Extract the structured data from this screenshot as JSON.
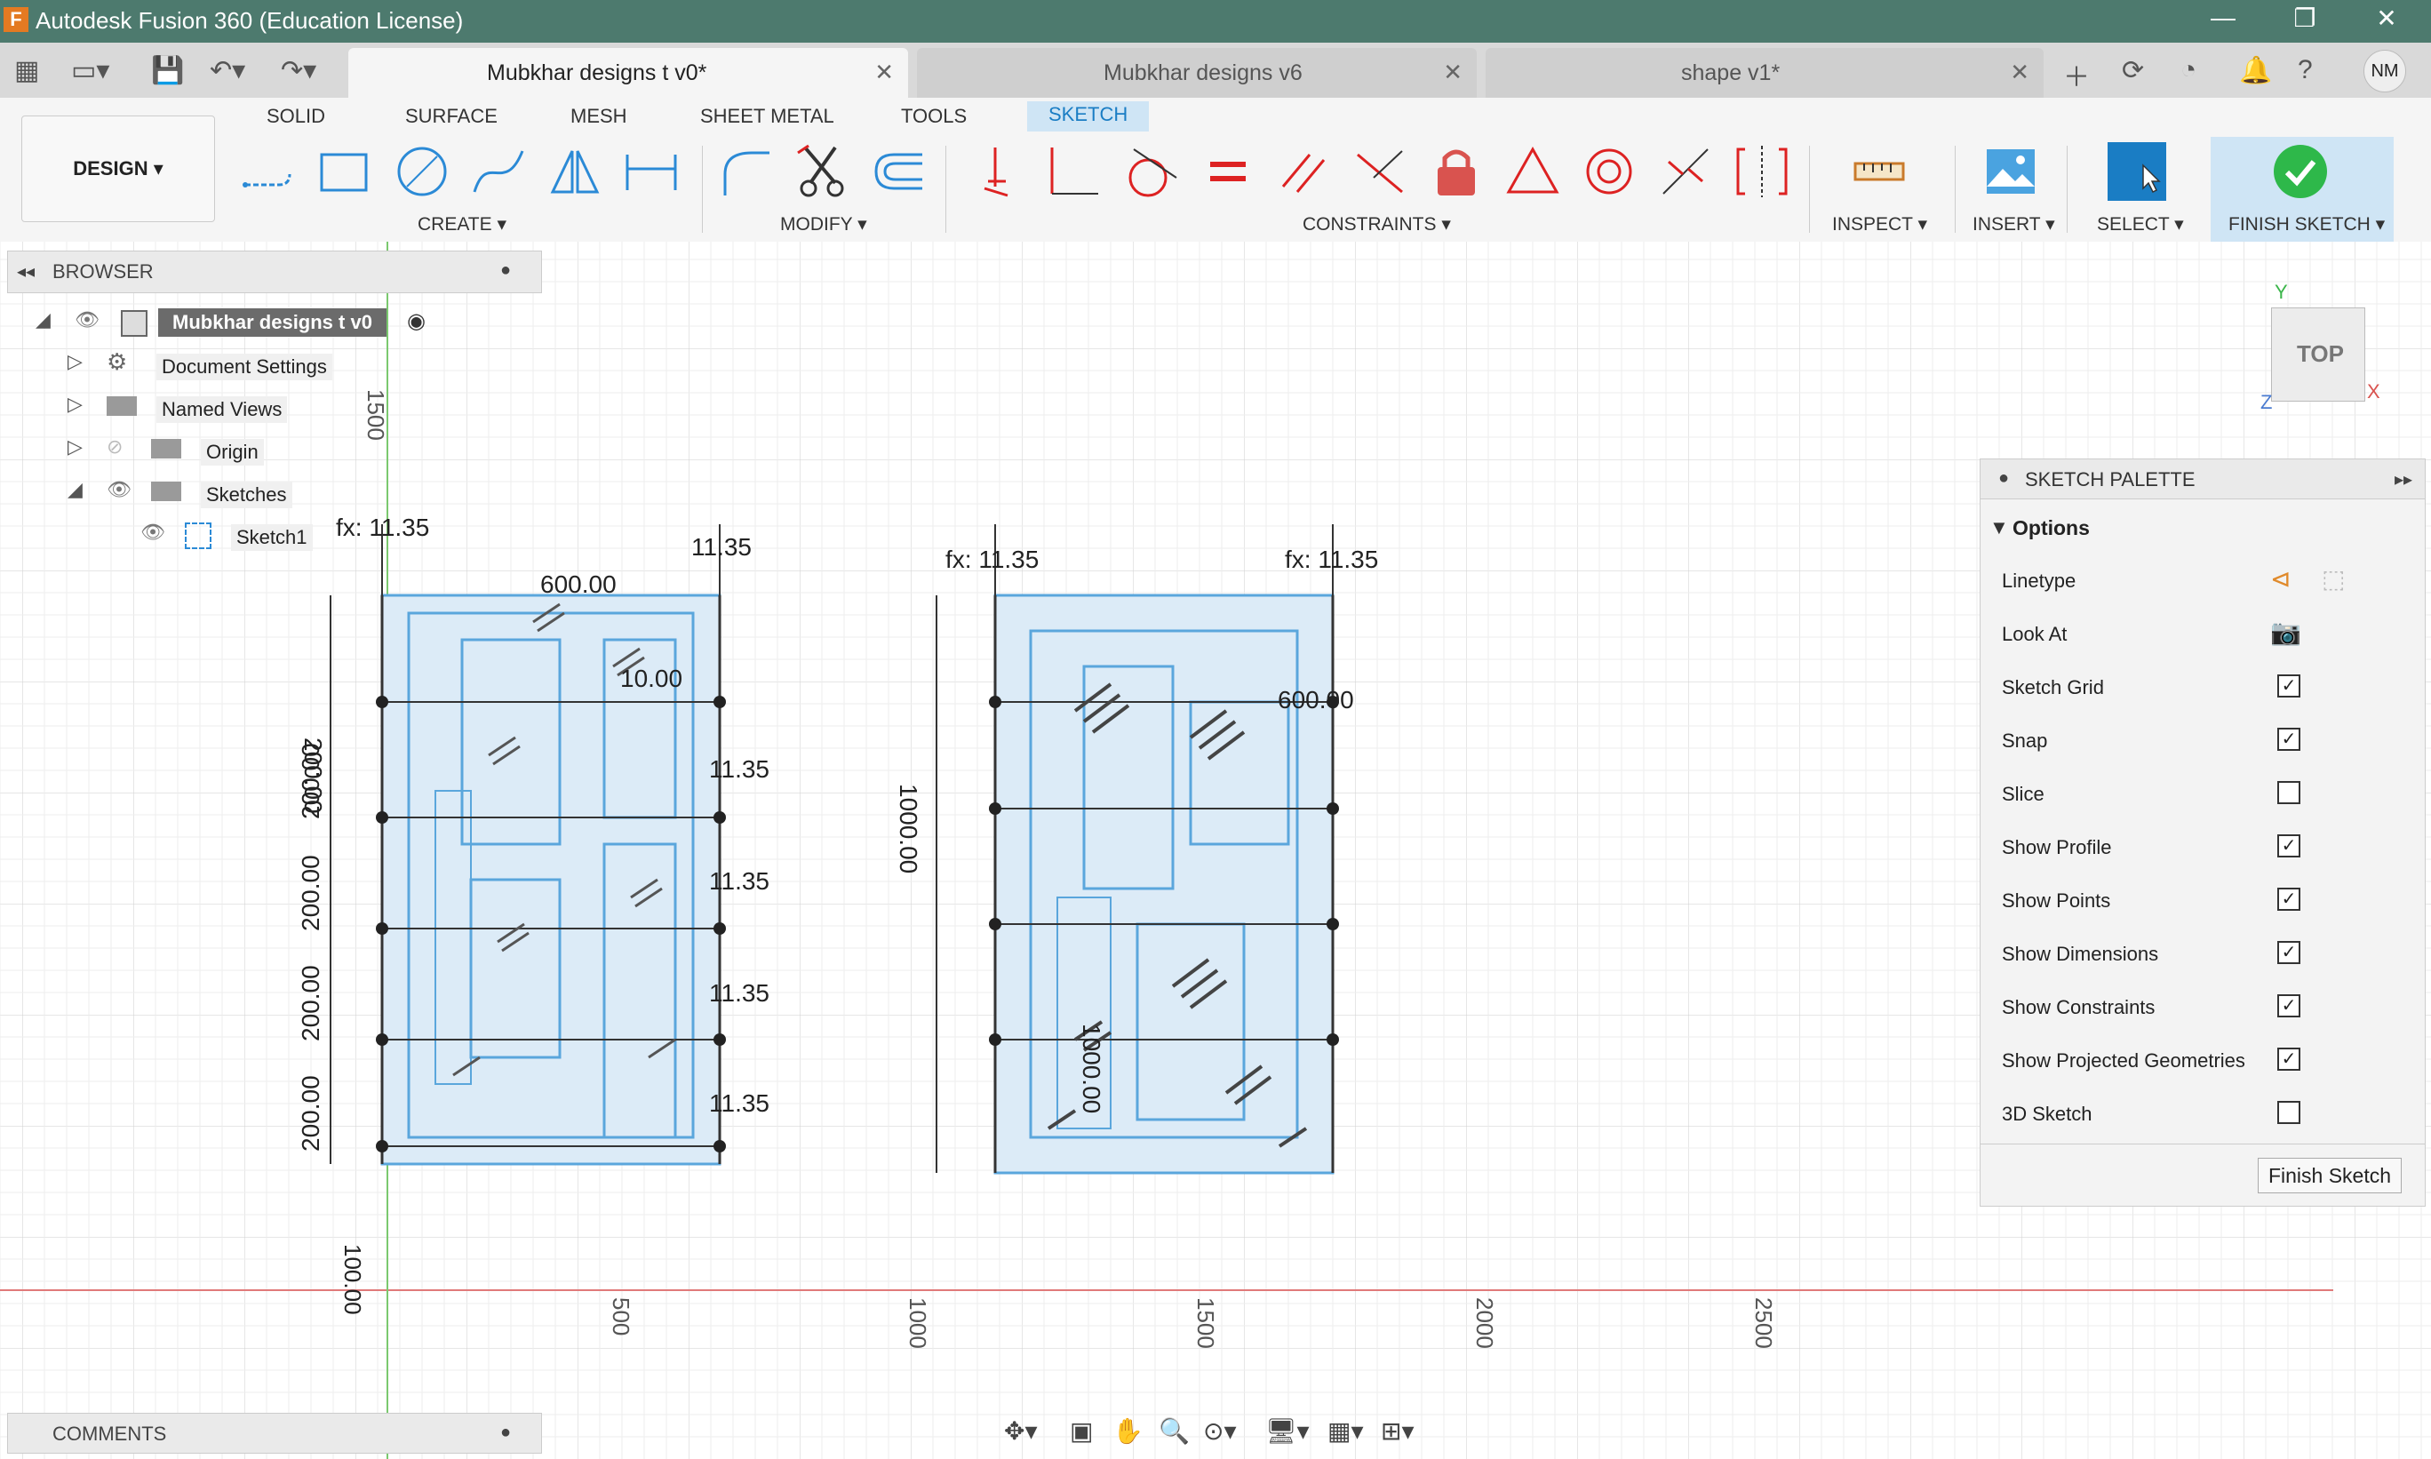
{
  "window": {
    "title": "Autodesk Fusion 360 (Education License)",
    "logo_letter": "F",
    "minimize": "—",
    "restore": "❐",
    "close": "✕"
  },
  "tabs": [
    {
      "label": "Mubkhar designs t v0*",
      "close": "✕"
    },
    {
      "label": "Mubkhar designs v6",
      "close": "✕"
    },
    {
      "label": "shape v1*",
      "close": "✕"
    }
  ],
  "user": {
    "initials": "NM"
  },
  "ribbon": {
    "workspace": "DESIGN ▾",
    "tabs": [
      "SOLID",
      "SURFACE",
      "MESH",
      "SHEET METAL",
      "TOOLS",
      "SKETCH"
    ],
    "groups": {
      "create": "CREATE ▾",
      "modify": "MODIFY ▾",
      "constraints": "CONSTRAINTS ▾",
      "inspect": "INSPECT ▾",
      "insert": "INSERT ▾",
      "select": "SELECT ▾",
      "finish": "FINISH SKETCH ▾"
    }
  },
  "browser": {
    "header": "BROWSER",
    "root": "Mubkhar designs t v0",
    "items": [
      "Document Settings",
      "Named Views",
      "Origin",
      "Sketches",
      "Sketch1"
    ]
  },
  "viewcube": {
    "face": "TOP",
    "axis_x": "X",
    "axis_y": "Y",
    "axis_z": "Z"
  },
  "sketch_palette": {
    "header": "SKETCH PALETTE",
    "section": "Options",
    "rows": [
      {
        "label": "Linetype"
      },
      {
        "label": "Look At"
      },
      {
        "label": "Sketch Grid",
        "checked": true
      },
      {
        "label": "Snap",
        "checked": true
      },
      {
        "label": "Slice",
        "checked": false
      },
      {
        "label": "Show Profile",
        "checked": true
      },
      {
        "label": "Show Points",
        "checked": true
      },
      {
        "label": "Show Dimensions",
        "checked": true
      },
      {
        "label": "Show Constraints",
        "checked": true
      },
      {
        "label": "Show Projected Geometries",
        "checked": true
      },
      {
        "label": "3D Sketch",
        "checked": false
      }
    ],
    "finish_button": "Finish Sketch"
  },
  "comments": {
    "header": "COMMENTS"
  },
  "canvas_labels": {
    "ruler_1500_top": "1500",
    "ruler_500": "500",
    "ruler_1000": "1000",
    "ruler_1500": "1500",
    "ruler_2000": "2000",
    "ruler_2500": "2500",
    "dim_600_a": "600.00",
    "dim_fx_a": "fx: 11.35",
    "dim_1135_a": "11.35",
    "dim_fx_b": "fx: 11.35",
    "dim_fx_c": "fx: 11.35",
    "dim_1000": "1000.00",
    "dim_200_1": "200.00",
    "dim_200_2": "200.00",
    "dim_200_3": "200.00",
    "dim_200_4": "200.00",
    "dim_200_5": "200.00",
    "dim_1000_b": "1000.00",
    "dim_600_b": "600.00",
    "dim_100": "100.00",
    "dim_10": "10.00",
    "dim_1135_b": "11.35",
    "dim_1135_c": "11.35",
    "dim_1135_d": "11.35",
    "dim_1135_e": "11.35"
  }
}
